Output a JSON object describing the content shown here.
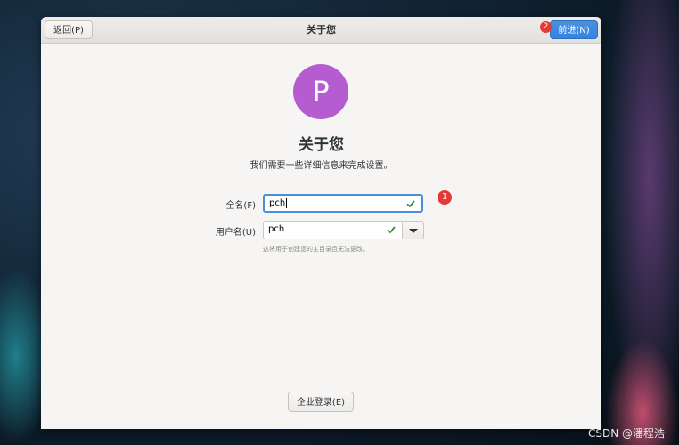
{
  "header": {
    "title": "关于您",
    "back_label": "返回(P)",
    "next_label": "前进(N)"
  },
  "markers": {
    "one": "1",
    "two": "2"
  },
  "avatar": {
    "initial": "P",
    "color": "#b55cd0"
  },
  "main": {
    "title": "关于您",
    "subtitle": "我们需要一些详细信息来完成设置。"
  },
  "form": {
    "fullname_label": "全名(F)",
    "fullname_value": "pch",
    "username_label": "用户名(U)",
    "username_value": "pch",
    "hint": "这将用于创建您的主目录且无法更改。"
  },
  "enterprise_login_label": "企业登录(E)",
  "watermark": "CSDN @潘程浩",
  "colors": {
    "accent": "#3584e4",
    "marker": "#e53935",
    "check": "#3b8a3b"
  }
}
